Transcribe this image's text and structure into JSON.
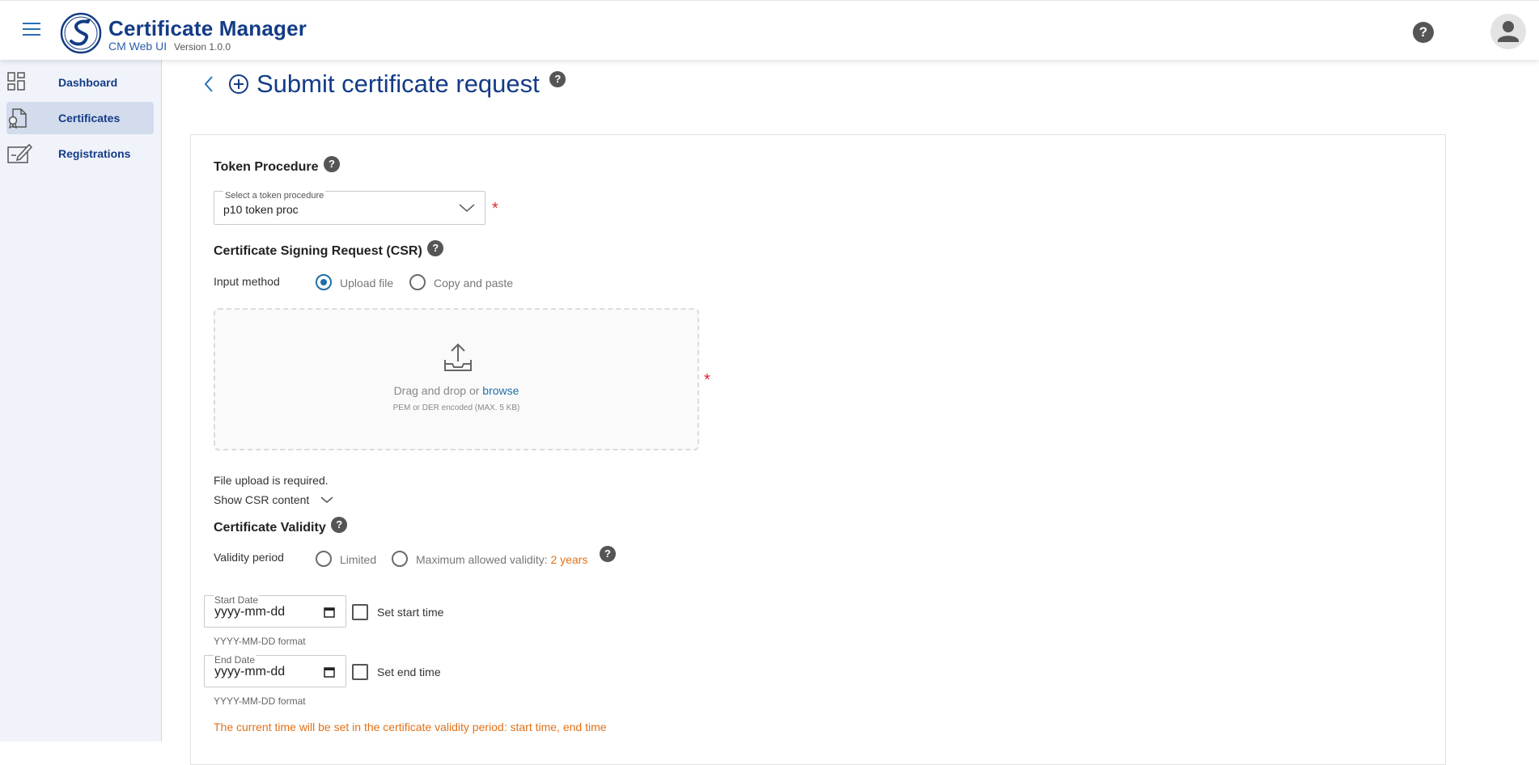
{
  "header": {
    "title": "Certificate Manager",
    "subtitle": "CM Web UI",
    "version": "Version 1.0.0"
  },
  "sidebar": {
    "items": [
      {
        "label": "Dashboard",
        "icon": "dashboard-icon",
        "active": false
      },
      {
        "label": "Certificates",
        "icon": "certificate-icon",
        "active": true
      },
      {
        "label": "Registrations",
        "icon": "edit-icon",
        "active": false
      }
    ]
  },
  "page": {
    "title": "Submit certificate request"
  },
  "token": {
    "section_title": "Token Procedure",
    "select_label": "Select a token procedure",
    "select_value": "p10 token proc",
    "required_mark": "*"
  },
  "csr": {
    "section_title": "Certificate Signing Request (CSR)",
    "input_method_label": "Input method",
    "options": [
      "Upload file",
      "Copy and paste"
    ],
    "selected": "Upload file",
    "dropzone_text": "Drag and drop or",
    "dropzone_link": "browse",
    "dropzone_hint": "PEM or DER encoded (MAX. 5 KB)",
    "required_mark": "*",
    "error_text": "File upload is required.",
    "show_content_label": "Show CSR content"
  },
  "validity": {
    "section_title": "Certificate Validity",
    "period_label": "Validity period",
    "options": [
      "Limited",
      "Maximum allowed validity:"
    ],
    "max_value": "2 years",
    "start_date_label": "Start Date",
    "start_date_value": "yyyy-mm-dd",
    "start_date_hint": "YYYY-MM-DD format",
    "set_start_time": "Set start time",
    "end_date_label": "End Date",
    "end_date_value": "yyyy-mm-dd",
    "end_date_hint": "YYYY-MM-DD format",
    "set_end_time": "Set end time",
    "warning": "The current time will be set in the certificate validity period: start time, end time"
  },
  "colors": {
    "brand": "#143c86",
    "link": "#1f6fa8",
    "required": "#e0262f",
    "warning": "#e27118",
    "sidebar_bg": "#f0f4fa",
    "sidebar_active": "#d3dced"
  }
}
